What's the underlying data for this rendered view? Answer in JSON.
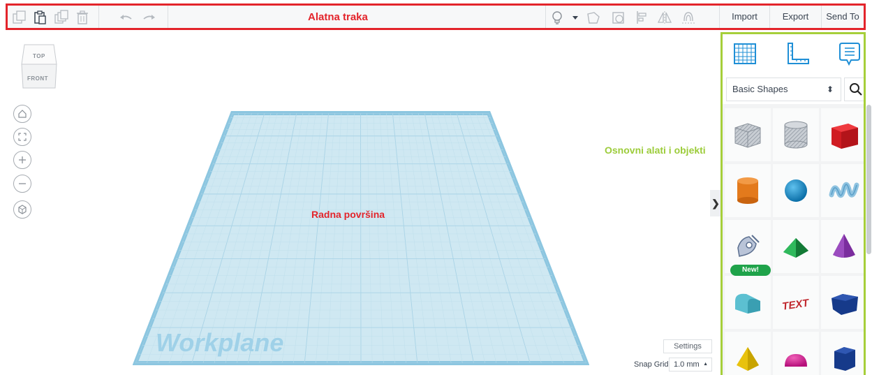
{
  "toolbar": {
    "annotation": "Alatna traka",
    "import_label": "Import",
    "export_label": "Export",
    "send_to_label": "Send To",
    "icons": [
      "copy-icon",
      "paste-icon",
      "duplicate-icon",
      "delete-icon",
      "undo-icon",
      "redo-icon",
      "lightbulb-icon",
      "chevron-down-icon",
      "group-icon",
      "ungroup-icon",
      "align-icon",
      "mirror-icon",
      "workplane-tool-icon"
    ],
    "annotation_color": "#e3242b"
  },
  "viewcube": {
    "top_label": "TOP",
    "front_label": "FRONT"
  },
  "nav_buttons": [
    "home-icon",
    "fit-view-icon",
    "zoom-in-icon",
    "zoom-out-icon",
    "perspective-icon"
  ],
  "workplane": {
    "label": "Workplane",
    "annotation": "Radna površina",
    "color": "#cfe8f2"
  },
  "panel": {
    "annotation": "Osnovni alati i objekti",
    "annotation_color": "#9ccc3a",
    "icons": [
      "workplane-grid-icon",
      "ruler-icon",
      "notes-icon"
    ],
    "category_label": "Basic Shapes",
    "new_badge": "New!",
    "shapes": [
      "box-hole",
      "cylinder-hole",
      "box",
      "cylinder",
      "sphere",
      "scribble",
      "shape-generator",
      "roof",
      "cone",
      "round-roof",
      "text",
      "wedge",
      "pyramid",
      "half-sphere",
      "polygon"
    ]
  },
  "settings": {
    "settings_label": "Settings",
    "snap_grid_label": "Snap Grid",
    "snap_value": "1.0 mm",
    "snap_arrow": "▲"
  },
  "collapse_chevron": "❯"
}
